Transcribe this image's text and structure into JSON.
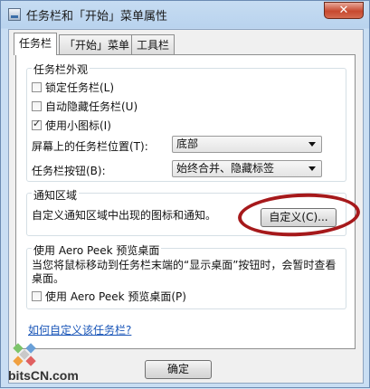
{
  "window": {
    "title": "任务栏和「开始」菜单属性",
    "close_label": "✕"
  },
  "tabs": [
    {
      "label": "任务栏",
      "active": true
    },
    {
      "label": "「开始」菜单",
      "active": false
    },
    {
      "label": "工具栏",
      "active": false
    }
  ],
  "appearance": {
    "title": "任务栏外观",
    "lock_taskbar": {
      "label": "锁定任务栏(L)",
      "checked": false
    },
    "auto_hide": {
      "label": "自动隐藏任务栏(U)",
      "checked": false
    },
    "small_icons": {
      "label": "使用小图标(I)",
      "checked": true
    },
    "location_label": "屏幕上的任务栏位置(T):",
    "location_value": "底部",
    "buttons_label": "任务栏按钮(B):",
    "buttons_value": "始终合并、隐藏标签"
  },
  "notification": {
    "title": "通知区域",
    "desc": "自定义通知区域中出现的图标和通知。",
    "customize_label": "自定义(C)..."
  },
  "aero": {
    "title": "使用 Aero Peek 预览桌面",
    "desc": "当您将鼠标移动到任务栏末端的“显示桌面”按钮时，会暂时查看桌面。",
    "checkbox_label": "使用 Aero Peek 预览桌面(P)",
    "checked": false
  },
  "help_link": "如何自定义该任务栏?",
  "footer": {
    "ok_label": "确定"
  },
  "watermark": {
    "text": "bitsCN.com"
  }
}
